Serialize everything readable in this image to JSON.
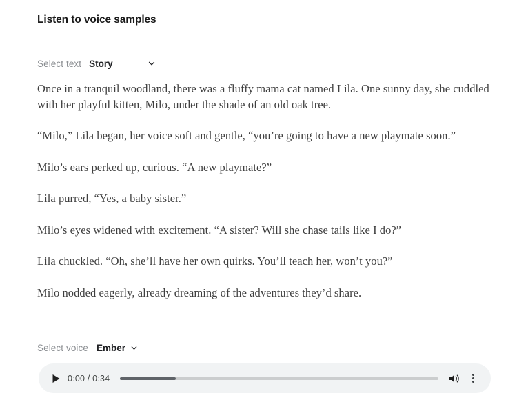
{
  "page": {
    "title": "Listen to voice samples",
    "background_color": "#ffffff"
  },
  "text_selector": {
    "label": "Select text",
    "selected_value": "Story",
    "chevron_icon": "chevron-down-icon"
  },
  "story": {
    "paragraphs": [
      "Once in a tranquil woodland, there was a fluffy mama cat named Lila. One sunny day, she cuddled with her playful kitten, Milo, under the shade of an old oak tree.",
      "“Milo,” Lila began, her voice soft and gentle, “you’re going to have a new playmate soon.”",
      "Milo’s ears perked up, curious. “A new playmate?”",
      "Lila purred, “Yes, a baby sister.”",
      "Milo’s eyes widened with excitement. “A sister? Will she chase tails like I do?”",
      "Lila chuckled. “Oh, she’ll have her own quirks. You’ll teach her, won’t you?”",
      "Milo nodded eagerly, already dreaming of the adventures they’d share."
    ]
  },
  "voice_selector": {
    "label": "Select voice",
    "selected_value": "Ember",
    "chevron_icon": "chevron-down-icon"
  },
  "audio_player": {
    "play_icon": "play-icon",
    "current_time": "0:00",
    "duration": "0:34",
    "time_display": "0:00 / 0:34",
    "progress_percent": 17.5,
    "volume_icon": "volume-icon",
    "more_icon": "more-vertical-icon",
    "track_color": "#cbcdce",
    "fill_color": "#5f6368",
    "background_color": "#f1f3f4"
  }
}
